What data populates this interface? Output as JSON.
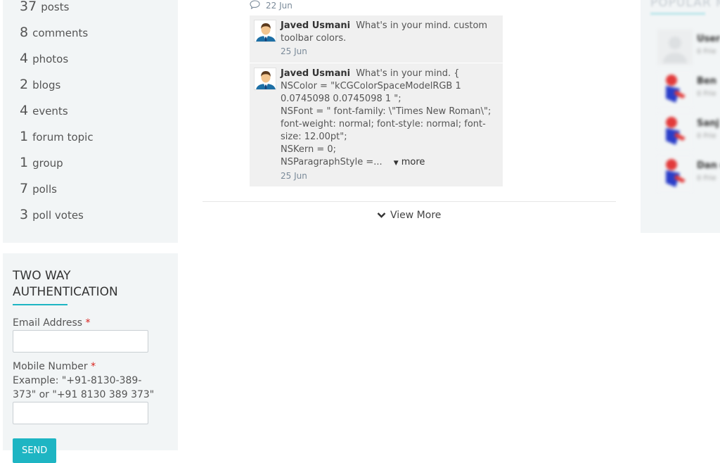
{
  "stats": [
    {
      "count": "37",
      "label": "posts"
    },
    {
      "count": "8",
      "label": "comments"
    },
    {
      "count": "4",
      "label": "photos"
    },
    {
      "count": "2",
      "label": "blogs"
    },
    {
      "count": "4",
      "label": "events"
    },
    {
      "count": "1",
      "label": "forum topic"
    },
    {
      "count": "1",
      "label": "group"
    },
    {
      "count": "7",
      "label": "polls"
    },
    {
      "count": "3",
      "label": "poll votes"
    }
  ],
  "auth": {
    "title": "TWO WAY AUTHENTICATION",
    "email_label": "Email Address",
    "required_marker": "*",
    "mobile_label": "Mobile Number",
    "mobile_hint": "Example: \"+91-8130-389-373\" or \"+91 8130 389 373\"",
    "email_value": "",
    "mobile_value": "",
    "send_label": "SEND",
    "accent_color": "#1eb5c3"
  },
  "feed": {
    "top_date": "22 Jun",
    "comments": [
      {
        "author": "Javed Usmani",
        "text": "What's in your mind. custom toolbar colors.",
        "date": "25 Jun"
      },
      {
        "author": "Javed Usmani",
        "text_lines": [
          "What's in your mind. {",
          "NSColor = \"kCGColorSpaceModelRGB 1 0.0745098 0.0745098 1 \";",
          "NSFont = \" font-family: \\\"Times New Roman\\\"; font-weight: normal; font-style: normal; font-size: 12.00pt\";",
          "NSKern = 0;",
          "NSParagraphStyle =..."
        ],
        "more_label": "more",
        "date": "25 Jun"
      }
    ],
    "view_more_label": "View More"
  },
  "popular": {
    "heading": "POPULAR M",
    "members": [
      {
        "name": "User",
        "sub": "0 Frie"
      },
      {
        "name": "Ben",
        "sub": "0 Frie"
      },
      {
        "name": "Sanj",
        "sub": "0 Frie"
      },
      {
        "name": "Dan c",
        "sub": "0 Frie"
      }
    ]
  }
}
